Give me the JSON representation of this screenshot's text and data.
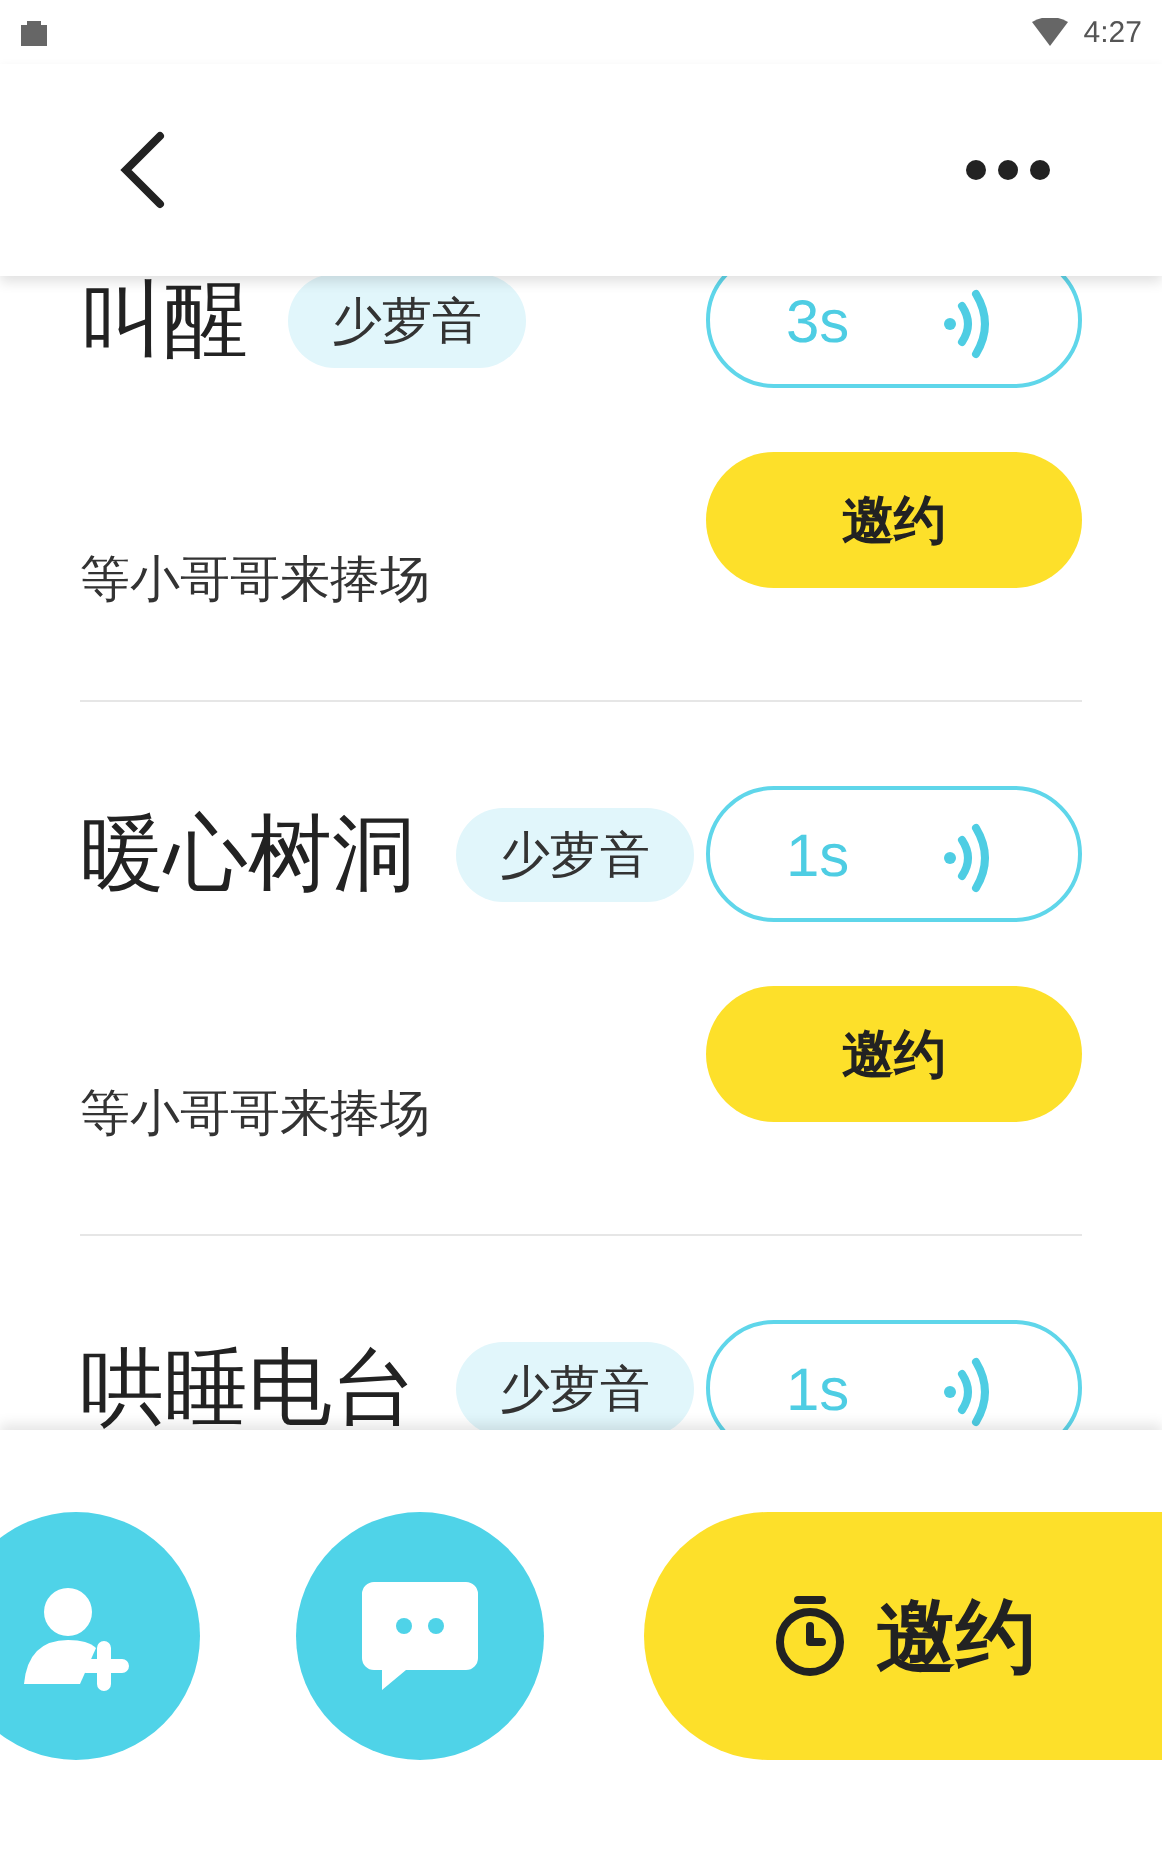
{
  "status_bar": {
    "time": "4:27"
  },
  "items": [
    {
      "title": "叫醒",
      "tag": "少萝音",
      "duration": "3s",
      "description": "等小哥哥来捧场",
      "action": "邀约"
    },
    {
      "title": "暖心树洞",
      "tag": "少萝音",
      "duration": "1s",
      "description": "等小哥哥来捧场",
      "action": "邀约"
    },
    {
      "title": "哄睡电台",
      "tag": "少萝音",
      "duration": "1s"
    }
  ],
  "bottom_bar": {
    "action": "邀约"
  }
}
